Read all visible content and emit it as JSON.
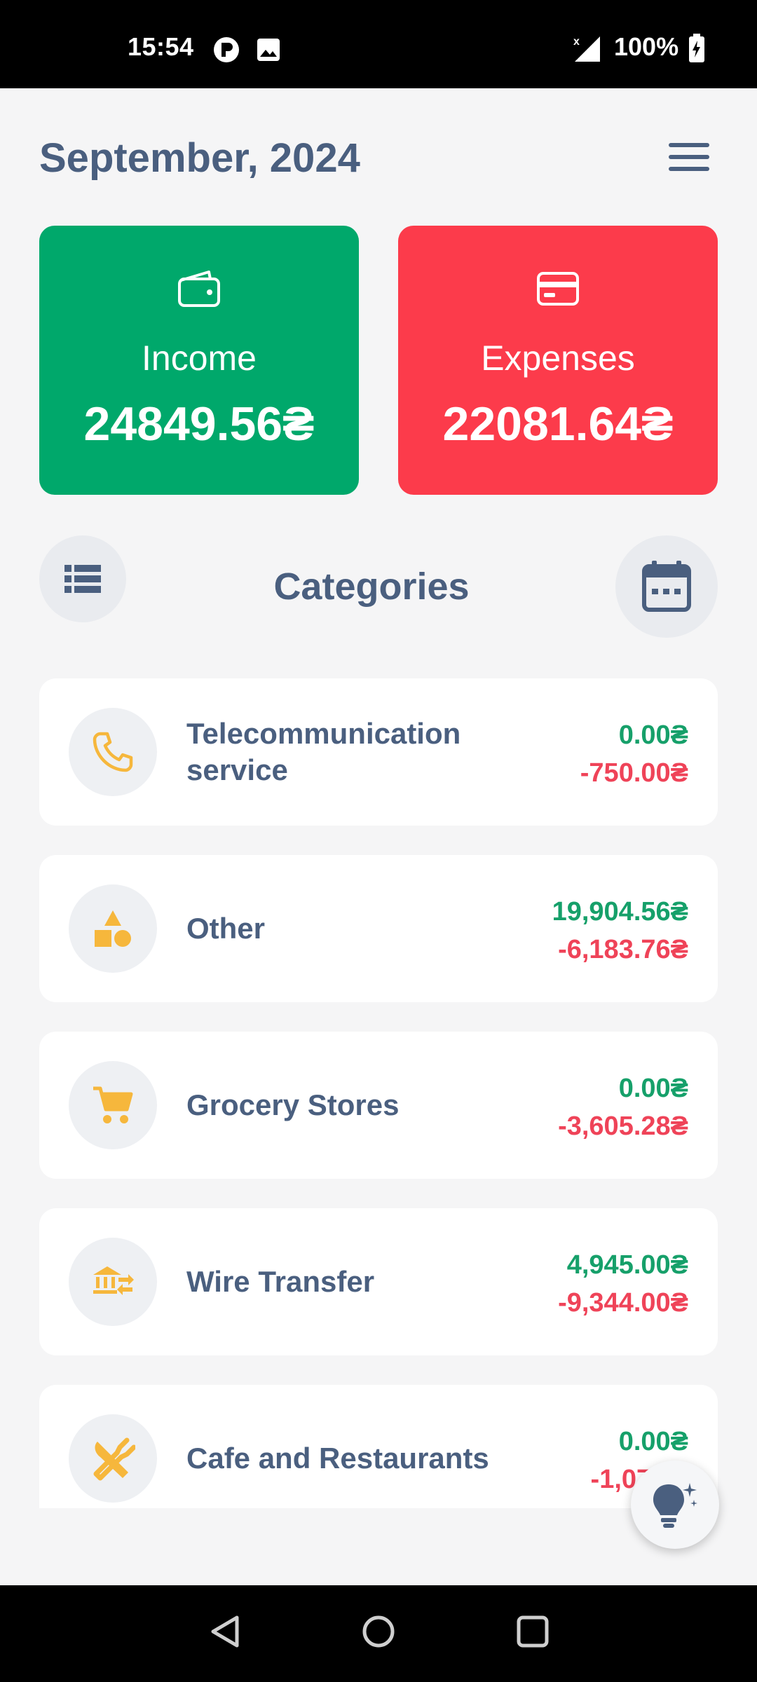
{
  "status_bar": {
    "time": "15:54",
    "battery": "100%",
    "icons": [
      "app-notification-icon",
      "gallery-notification-icon",
      "signal-icon",
      "battery-charging-icon"
    ]
  },
  "header": {
    "title": "September, 2024",
    "menu_icon": "hamburger-menu-icon"
  },
  "summary": {
    "income": {
      "label": "Income",
      "amount": "24849.56₴",
      "icon": "wallet-icon",
      "color": "#00a86b"
    },
    "expenses": {
      "label": "Expenses",
      "amount": "22081.64₴",
      "icon": "credit-card-icon",
      "color": "#fc3b4b"
    }
  },
  "categories_section": {
    "title": "Categories",
    "list_view_icon": "list-view-icon",
    "calendar_icon": "calendar-icon"
  },
  "categories": [
    {
      "name": "Telecommunication service",
      "icon": "phone-icon",
      "income": "0.00₴",
      "expense": "-750.00₴"
    },
    {
      "name": "Other",
      "icon": "shapes-icon",
      "income": "19,904.56₴",
      "expense": "-6,183.76₴"
    },
    {
      "name": "Grocery Stores",
      "icon": "shopping-cart-icon",
      "income": "0.00₴",
      "expense": "-3,605.28₴"
    },
    {
      "name": "Wire Transfer",
      "icon": "bank-transfer-icon",
      "income": "4,945.00₴",
      "expense": "-9,344.00₴"
    },
    {
      "name": "Cafe and Restaurants",
      "icon": "cutlery-icon",
      "income": "0.00₴",
      "expense": "-1,071.5"
    }
  ],
  "fab": {
    "icon": "lightbulb-sparkle-icon"
  },
  "colors": {
    "income": "#16a06a",
    "expense": "#ef4358",
    "category_icon": "#f6b73c",
    "text": "#4a5f7f"
  },
  "nav_bar": {
    "icons": [
      "back-icon",
      "home-icon",
      "recents-icon"
    ]
  }
}
